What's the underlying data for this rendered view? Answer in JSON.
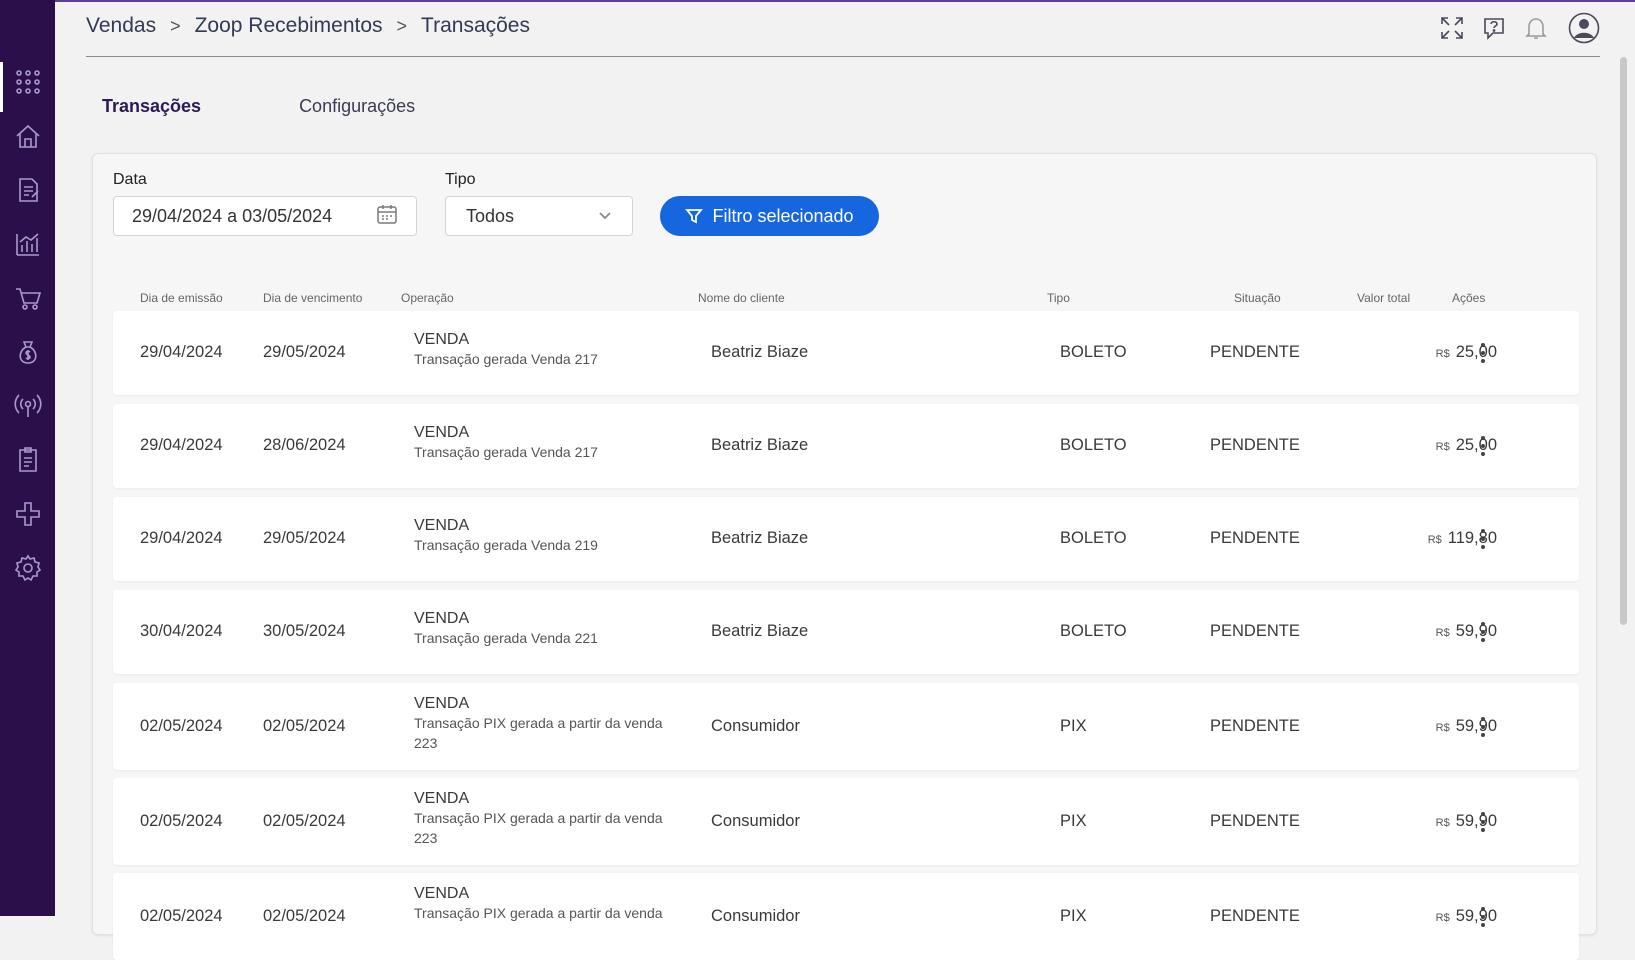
{
  "breadcrumb": {
    "level1": "Vendas",
    "level2": "Zoop Recebimentos",
    "level3": "Transações",
    "separator": ">"
  },
  "header_icons": [
    "expand-icon",
    "help-chat-icon",
    "bell-icon",
    "user-avatar-icon"
  ],
  "sidebar_icons": [
    "apps-grid-icon",
    "home-icon",
    "document-icon",
    "chart-icon",
    "cart-icon",
    "money-bag-icon",
    "broadcast-icon",
    "report-icon",
    "integration-icon",
    "gear-icon"
  ],
  "tabs": [
    {
      "label": "Transações",
      "active": true
    },
    {
      "label": "Configurações",
      "active": false
    }
  ],
  "filters": {
    "date_label": "Data",
    "date_value": "29/04/2024 a 03/05/2024",
    "type_label": "Tipo",
    "type_value": "Todos",
    "filter_button": "Filtro selecionado"
  },
  "columns": {
    "emissao": "Dia de emissão",
    "vencimento": "Dia de vencimento",
    "operacao": "Operação",
    "cliente": "Nome do cliente",
    "tipo": "Tipo",
    "situacao": "Situação",
    "valor": "Valor total",
    "acoes": "Ações"
  },
  "currency_symbol": "R$",
  "rows": [
    {
      "emissao": "29/04/2024",
      "vencimento": "29/05/2024",
      "op_title": "VENDA",
      "op_sub": "Transação gerada Venda 217",
      "cliente": "Beatriz Biaze",
      "tipo": "BOLETO",
      "situacao": "PENDENTE",
      "valor": "25,00"
    },
    {
      "emissao": "29/04/2024",
      "vencimento": "28/06/2024",
      "op_title": "VENDA",
      "op_sub": "Transação gerada Venda 217",
      "cliente": "Beatriz Biaze",
      "tipo": "BOLETO",
      "situacao": "PENDENTE",
      "valor": "25,00"
    },
    {
      "emissao": "29/04/2024",
      "vencimento": "29/05/2024",
      "op_title": "VENDA",
      "op_sub": "Transação gerada Venda 219",
      "cliente": "Beatriz Biaze",
      "tipo": "BOLETO",
      "situacao": "PENDENTE",
      "valor": "119,80"
    },
    {
      "emissao": "30/04/2024",
      "vencimento": "30/05/2024",
      "op_title": "VENDA",
      "op_sub": "Transação gerada Venda 221",
      "cliente": "Beatriz Biaze",
      "tipo": "BOLETO",
      "situacao": "PENDENTE",
      "valor": "59,90"
    },
    {
      "emissao": "02/05/2024",
      "vencimento": "02/05/2024",
      "op_title": "VENDA",
      "op_sub": "Transação PIX gerada a partir da venda 223",
      "cliente": "Consumidor",
      "tipo": "PIX",
      "situacao": "PENDENTE",
      "valor": "59,90"
    },
    {
      "emissao": "02/05/2024",
      "vencimento": "02/05/2024",
      "op_title": "VENDA",
      "op_sub": "Transação PIX gerada a partir da venda 223",
      "cliente": "Consumidor",
      "tipo": "PIX",
      "situacao": "PENDENTE",
      "valor": "59,90"
    },
    {
      "emissao": "02/05/2024",
      "vencimento": "02/05/2024",
      "op_title": "VENDA",
      "op_sub": "Transação PIX gerada a partir da venda",
      "cliente": "Consumidor",
      "tipo": "PIX",
      "situacao": "PENDENTE",
      "valor": "59,90"
    }
  ],
  "colors": {
    "sidebar": "#2b0f4a",
    "primary_button": "#1666e0",
    "tab_active": "#2b1a55"
  }
}
